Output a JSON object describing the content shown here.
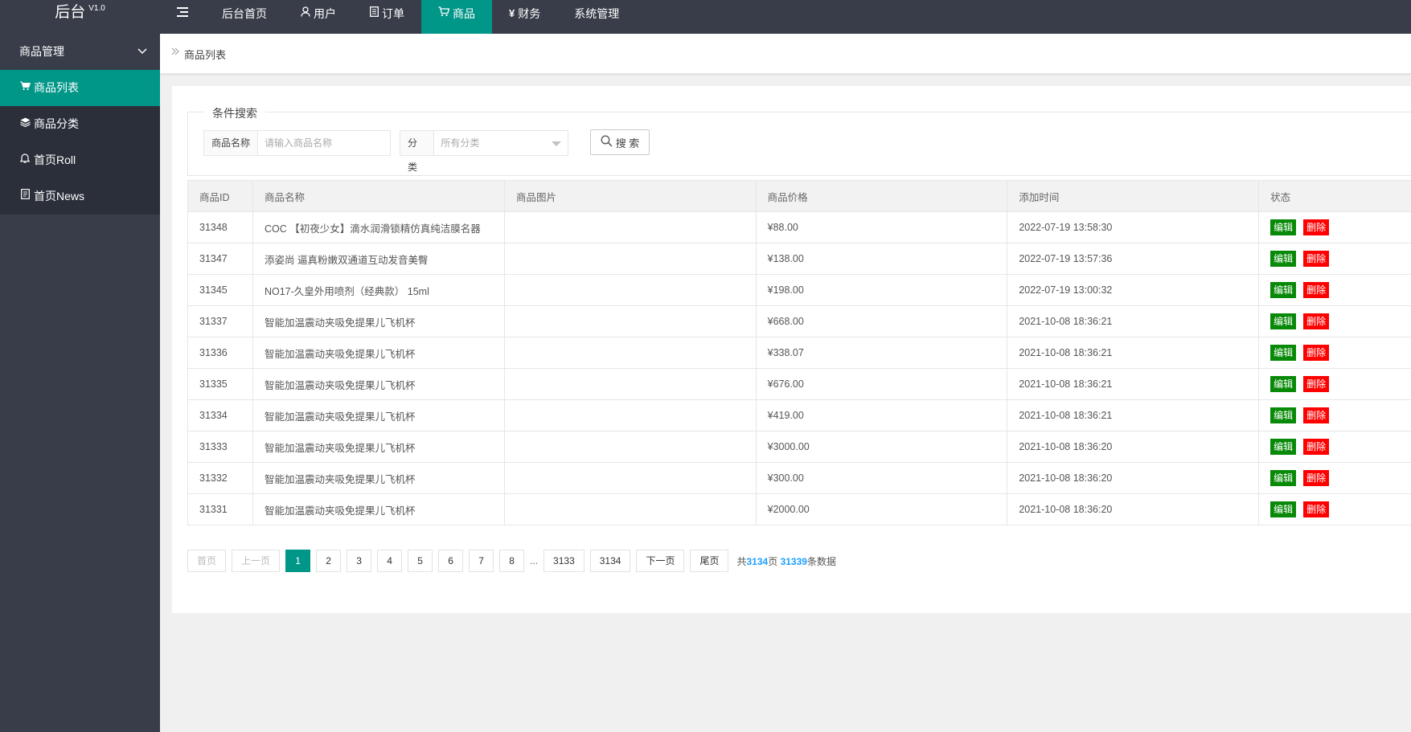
{
  "header": {
    "logo": "后台",
    "version": "V1.0",
    "nav": [
      {
        "label": "后台首页",
        "icon": ""
      },
      {
        "label": "用户",
        "icon": "user-icon"
      },
      {
        "label": "订单",
        "icon": "document-icon"
      },
      {
        "label": "商品",
        "icon": "cart-icon"
      },
      {
        "label": "财务",
        "icon": "yen-icon"
      },
      {
        "label": "系统管理",
        "icon": ""
      }
    ],
    "accent": "#009688",
    "background": "#393d49"
  },
  "sidebar": {
    "group": "商品管理",
    "items": [
      {
        "label": "商品列表",
        "icon": "cart-icon"
      },
      {
        "label": "商品分类",
        "icon": "layers-icon"
      },
      {
        "label": "首页Roll",
        "icon": "bell-icon"
      },
      {
        "label": "首页News",
        "icon": "note-icon"
      }
    ]
  },
  "breadcrumb": "商品列表",
  "search": {
    "legend": "条件搜索",
    "name_label": "商品名称",
    "name_placeholder": "请输入商品名称",
    "category_label": "分类",
    "category_value": "所有分类",
    "button": "搜 索"
  },
  "table": {
    "columns": [
      "商品ID",
      "商品名称",
      "商品图片",
      "商品价格",
      "添加时间",
      "状态"
    ],
    "edit_label": "编辑",
    "delete_label": "删除",
    "rows": [
      {
        "id": "31348",
        "name": "COC 【初夜少女】滴水润滑锁精仿真纯洁膜名器",
        "image": "",
        "price": "¥88.00",
        "time": "2022-07-19 13:58:30"
      },
      {
        "id": "31347",
        "name": "添姿尚 逼真粉嫩双通道互动发音美臀",
        "image": "",
        "price": "¥138.00",
        "time": "2022-07-19 13:57:36"
      },
      {
        "id": "31345",
        "name": "NO17-久皇外用喷剂（经典款） 15ml",
        "image": "",
        "price": "¥198.00",
        "time": "2022-07-19 13:00:32"
      },
      {
        "id": "31337",
        "name": "智能加温震动夹吸免提果儿飞机杯",
        "image": "",
        "price": "¥668.00",
        "time": "2021-10-08 18:36:21"
      },
      {
        "id": "31336",
        "name": "智能加温震动夹吸免提果儿飞机杯",
        "image": "",
        "price": "¥338.07",
        "time": "2021-10-08 18:36:21"
      },
      {
        "id": "31335",
        "name": "智能加温震动夹吸免提果儿飞机杯",
        "image": "",
        "price": "¥676.00",
        "time": "2021-10-08 18:36:21"
      },
      {
        "id": "31334",
        "name": "智能加温震动夹吸免提果儿飞机杯",
        "image": "",
        "price": "¥419.00",
        "time": "2021-10-08 18:36:21"
      },
      {
        "id": "31333",
        "name": "智能加温震动夹吸免提果儿飞机杯",
        "image": "",
        "price": "¥3000.00",
        "time": "2021-10-08 18:36:20"
      },
      {
        "id": "31332",
        "name": "智能加温震动夹吸免提果儿飞机杯",
        "image": "",
        "price": "¥300.00",
        "time": "2021-10-08 18:36:20"
      },
      {
        "id": "31331",
        "name": "智能加温震动夹吸免提果儿飞机杯",
        "image": "",
        "price": "¥2000.00",
        "time": "2021-10-08 18:36:20"
      }
    ]
  },
  "pagination": {
    "first": "首页",
    "prev": "上一页",
    "pages": [
      "1",
      "2",
      "3",
      "4",
      "5",
      "6",
      "7",
      "8"
    ],
    "current": "1",
    "ellipsis": "...",
    "tail_pages": [
      "3133",
      "3134"
    ],
    "next": "下一页",
    "last": "尾页",
    "summary_prefix": "共",
    "total_pages": "3134",
    "summary_mid": "页",
    "total_records": "31339",
    "summary_suffix": "条数据"
  }
}
